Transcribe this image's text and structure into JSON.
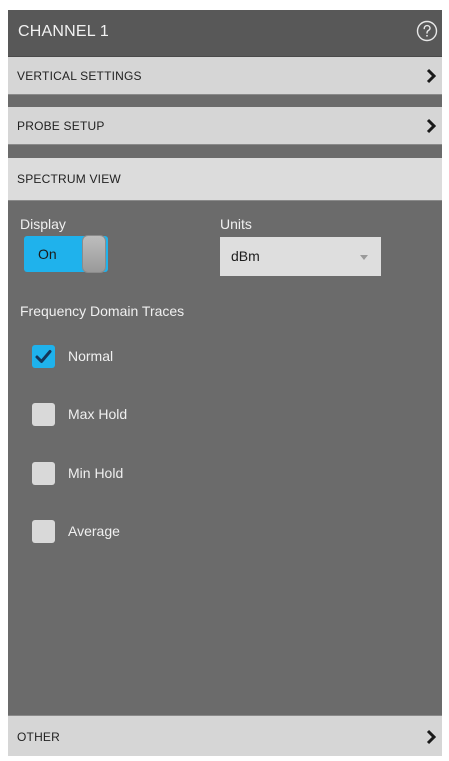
{
  "header": {
    "title": "CHANNEL 1",
    "help_icon": "help-circle-icon"
  },
  "sections": {
    "vertical_settings": "VERTICAL SETTINGS",
    "probe_setup": "PROBE SETUP",
    "spectrum_view": "SPECTRUM VIEW",
    "other": "OTHER"
  },
  "display": {
    "label": "Display",
    "toggle_value": "On"
  },
  "units": {
    "label": "Units",
    "value": "dBm"
  },
  "traces": {
    "label": "Frequency Domain Traces",
    "items": [
      {
        "label": "Normal",
        "checked": true
      },
      {
        "label": "Max Hold",
        "checked": false
      },
      {
        "label": "Min Hold",
        "checked": false
      },
      {
        "label": "Average",
        "checked": false
      }
    ]
  },
  "colors": {
    "accent": "#1fb2ec",
    "panel_bg": "#6b6b6b",
    "header_bg": "#585858",
    "section_bg": "#d6d6d6"
  }
}
